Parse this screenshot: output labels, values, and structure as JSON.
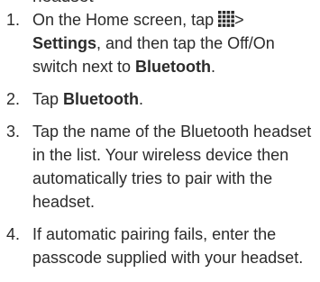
{
  "heading_fragment": "headset",
  "steps": [
    {
      "number": "1.",
      "parts": {
        "a": "On the Home screen, tap ",
        "chevron": ">",
        "settings": "Settings",
        "b": ", and then tap the Off/On switch next to ",
        "bluetooth": "Bluetooth",
        "c": "."
      },
      "icon": "apps-grid-icon"
    },
    {
      "number": "2.",
      "parts": {
        "a": "Tap ",
        "bluetooth": "Bluetooth",
        "c": "."
      }
    },
    {
      "number": "3.",
      "text": "Tap the name of the Bluetooth headset in the list. Your wireless device then automatically tries to pair with the headset."
    },
    {
      "number": "4.",
      "text": "If automatic pairing fails, enter the passcode supplied with your headset."
    }
  ]
}
